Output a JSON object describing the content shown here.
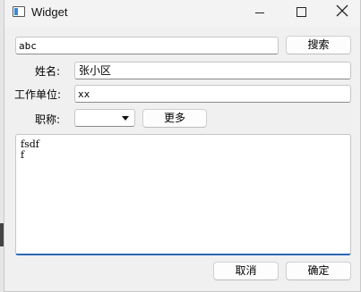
{
  "window": {
    "title": "Widget"
  },
  "search": {
    "value": "abc",
    "button_label": "搜索"
  },
  "form": {
    "name_label": "姓名:",
    "name_value": "张小区",
    "org_label": "工作单位:",
    "org_value": "xx",
    "title_label": "职称:",
    "title_value": "",
    "more_label": "更多"
  },
  "notes": {
    "lines": [
      "fsdf",
      "f"
    ]
  },
  "footer": {
    "cancel_label": "取消",
    "ok_label": "确定"
  }
}
